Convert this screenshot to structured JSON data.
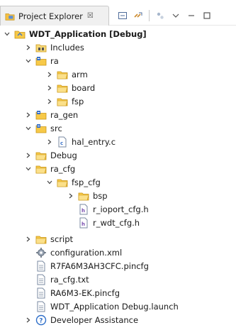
{
  "panel": {
    "tab_title": "Project Explorer",
    "tab_close": "☒"
  },
  "tree": {
    "project": "WDT_Application [Debug]",
    "includes": "Includes",
    "ra": "ra",
    "arm": "arm",
    "board": "board",
    "fsp": "fsp",
    "ra_gen": "ra_gen",
    "src": "src",
    "hal_entry": "hal_entry.c",
    "debug": "Debug",
    "ra_cfg": "ra_cfg",
    "fsp_cfg": "fsp_cfg",
    "bsp": "bsp",
    "r_ioport_cfg": "r_ioport_cfg.h",
    "r_wdt_cfg": "r_wdt_cfg.h",
    "script": "script",
    "configuration": "configuration.xml",
    "pincfg1": "R7FA6M3AH3CFC.pincfg",
    "ra_cfg_txt": "ra_cfg.txt",
    "pincfg2": "RA6M3-EK.pincfg",
    "launch": "WDT_Application Debug.launch",
    "developer": "Developer Assistance"
  },
  "icons": {
    "folder": "folder-icon",
    "source_folder": "source-folder-icon",
    "project": "project-icon",
    "file": "file-icon",
    "c_file": "c-file-icon",
    "h_file": "h-file-icon",
    "gear": "gear-icon",
    "help": "help-icon"
  }
}
